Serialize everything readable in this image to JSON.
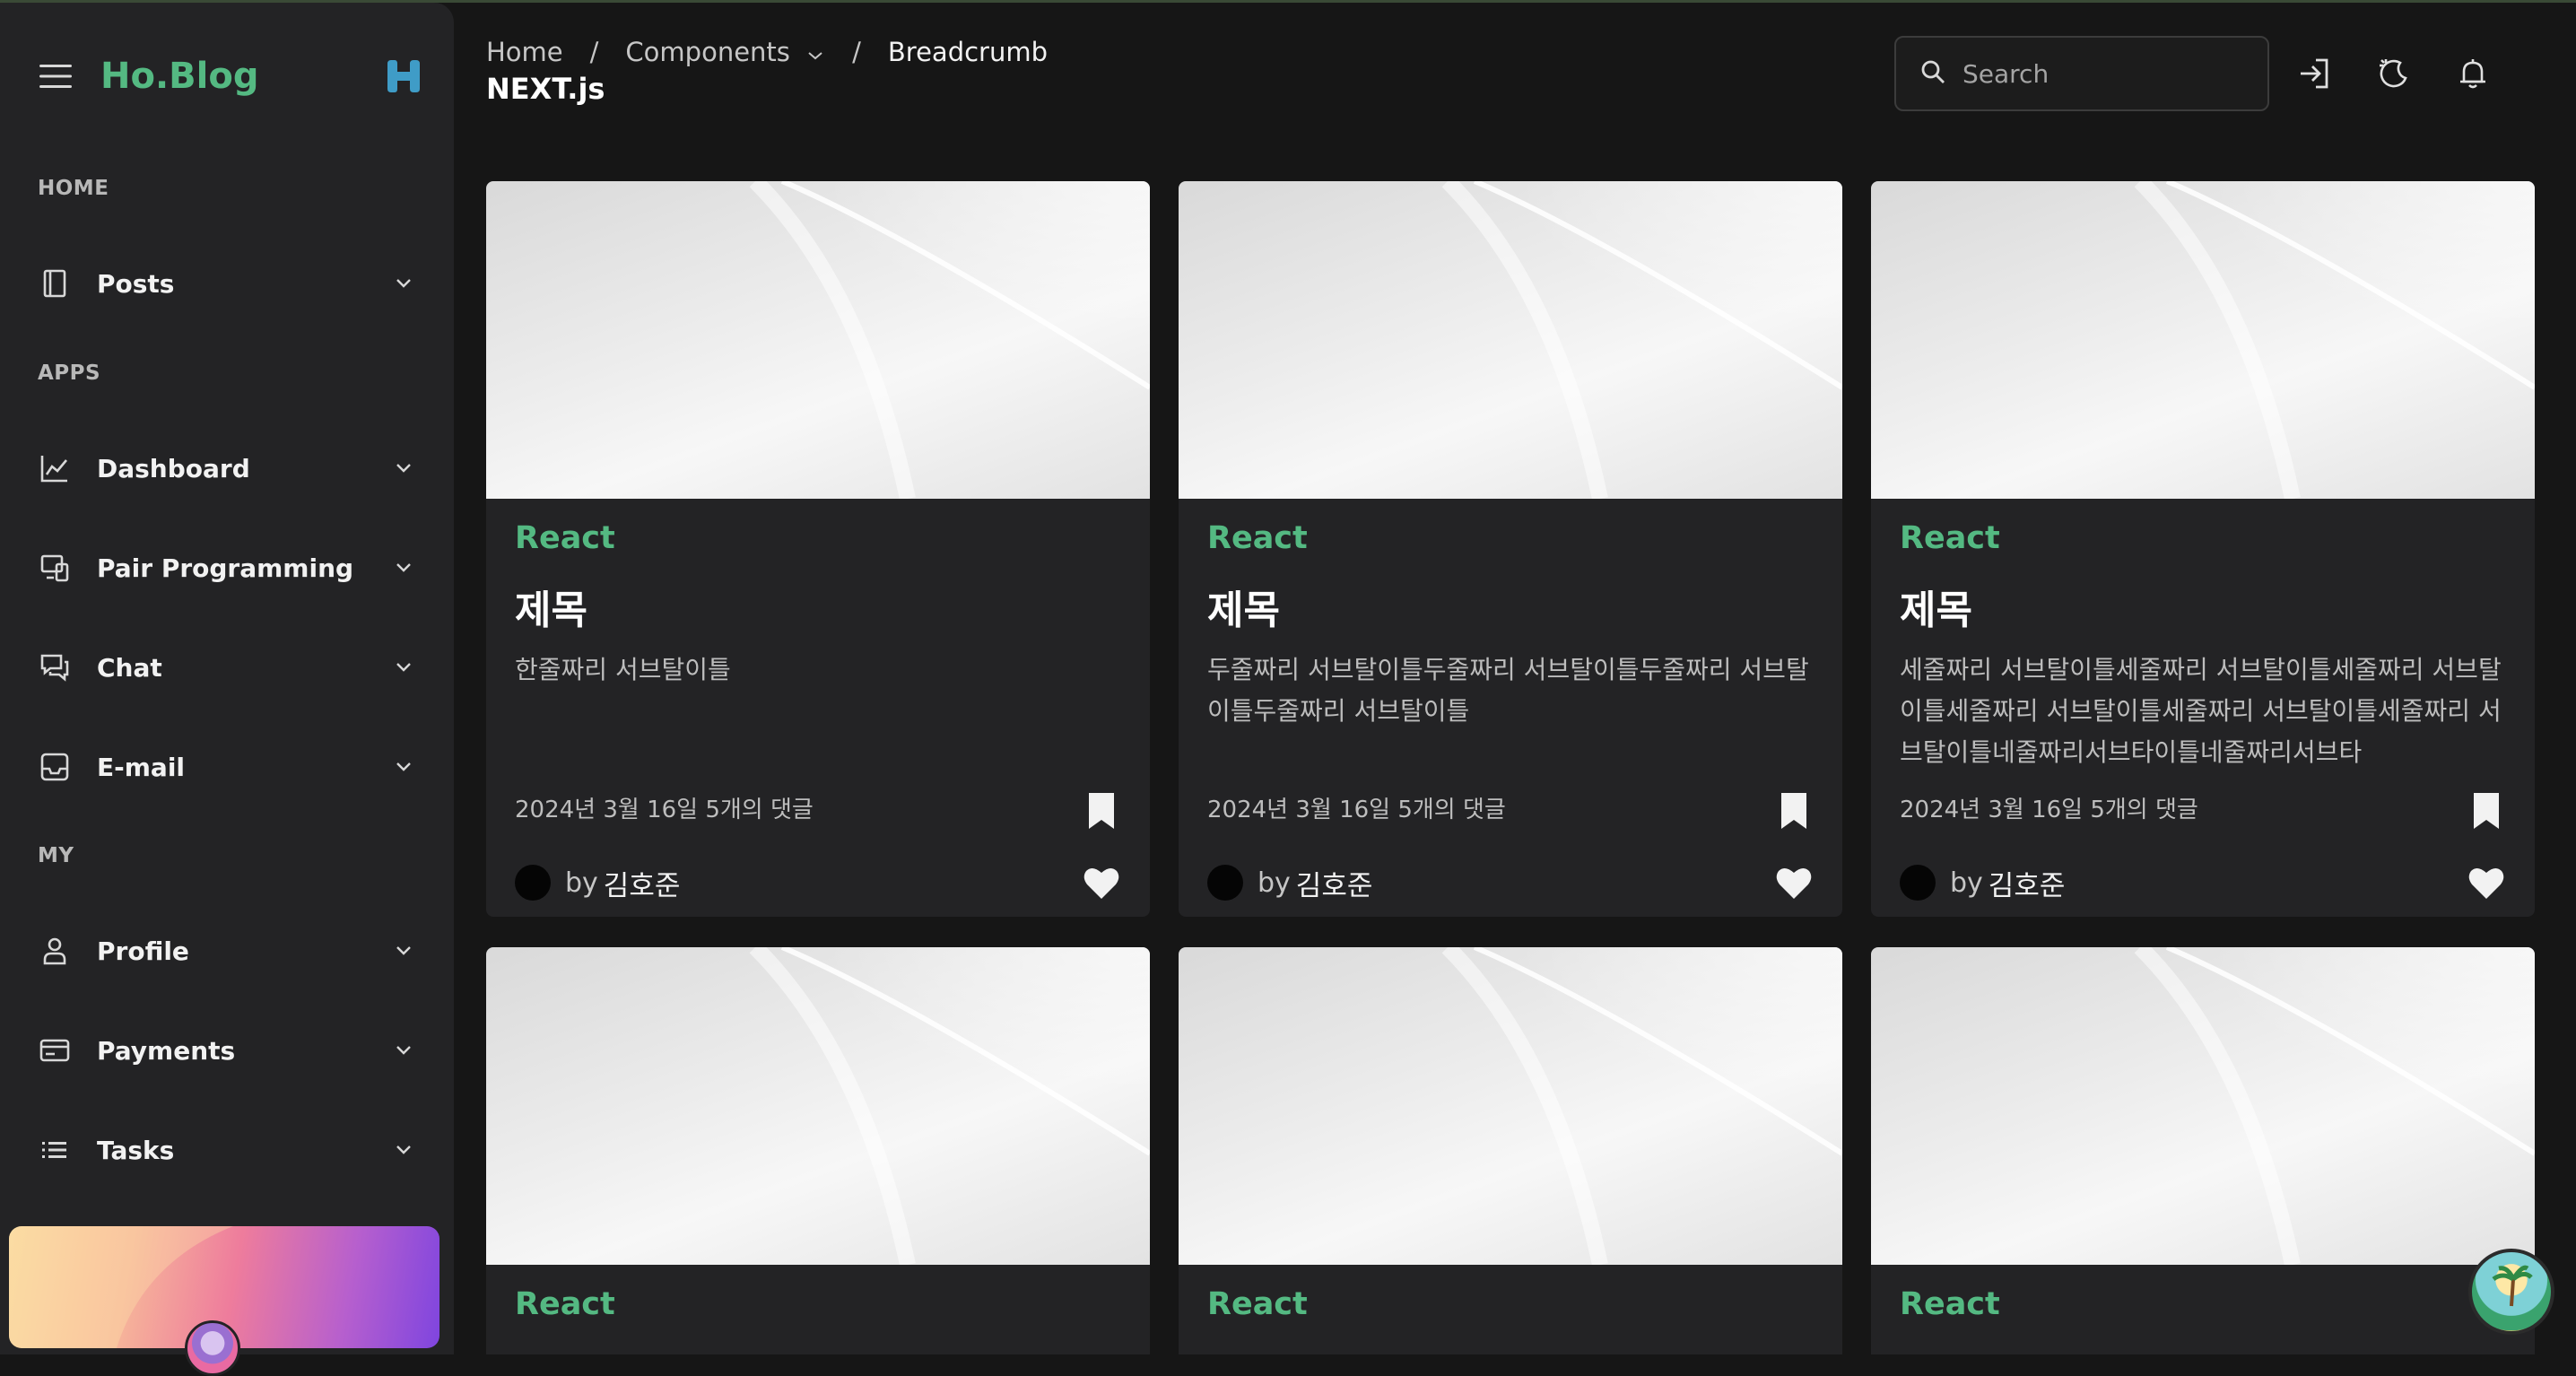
{
  "brand": {
    "name": "Ho.Blog",
    "logo_icon": "h-logo-icon",
    "accent": "#54b982"
  },
  "sidebar": {
    "sections": [
      {
        "label": "HOME",
        "items": [
          {
            "label": "Posts",
            "icon": "book-icon"
          }
        ]
      },
      {
        "label": "APPS",
        "items": [
          {
            "label": "Dashboard",
            "icon": "chart-line-icon"
          },
          {
            "label": "Pair Programming",
            "icon": "devices-icon"
          },
          {
            "label": "Chat",
            "icon": "chat-icon"
          },
          {
            "label": "E-mail",
            "icon": "inbox-icon"
          }
        ]
      },
      {
        "label": "MY",
        "items": [
          {
            "label": "Profile",
            "icon": "user-icon"
          },
          {
            "label": "Payments",
            "icon": "credit-card-icon"
          },
          {
            "label": "Tasks",
            "icon": "list-icon"
          }
        ]
      }
    ]
  },
  "header": {
    "breadcrumb": [
      {
        "label": "Home"
      },
      {
        "label": "Components",
        "has_dropdown": true
      },
      {
        "label": "Breadcrumb"
      }
    ],
    "separator": "/",
    "page_title": "NEXT.js",
    "search": {
      "placeholder": "Search",
      "value": ""
    },
    "actions": [
      "login-icon",
      "theme-toggle-icon",
      "bell-icon"
    ]
  },
  "cards": [
    {
      "category": "React",
      "title": "제목",
      "subtitle": "한줄짜리 서브탈이틀",
      "meta": "2024년 3월 16일 5개의 댓글",
      "author_prefix": "by",
      "author": "김호준"
    },
    {
      "category": "React",
      "title": "제목",
      "subtitle": "두줄짜리 서브탈이틀두줄짜리 서브탈이틀두줄짜리 서브탈이틀두줄짜리 서브탈이틀",
      "meta": "2024년 3월 16일 5개의 댓글",
      "author_prefix": "by",
      "author": "김호준"
    },
    {
      "category": "React",
      "title": "제목",
      "subtitle": "세줄짜리 서브탈이틀세줄짜리 서브탈이틀세줄짜리 서브탈이틀세줄짜리 서브탈이틀세줄짜리 서브탈이틀세줄짜리 서브탈이틀네줄짜리서브타이틀네줄짜리서브타",
      "meta": "2024년 3월 16일 5개의 댓글",
      "author_prefix": "by",
      "author": "김호준"
    },
    {
      "category": "React"
    },
    {
      "category": "React"
    },
    {
      "category": "React"
    }
  ]
}
